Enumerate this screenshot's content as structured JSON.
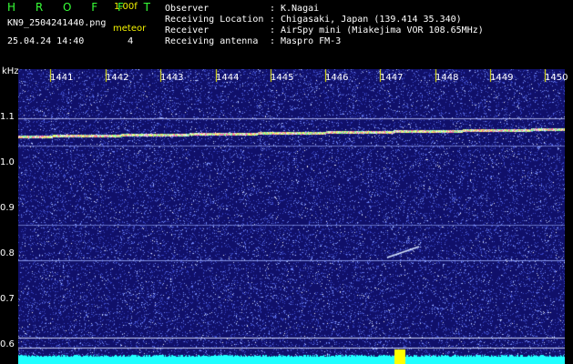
{
  "app": {
    "brand": "H R O F F T",
    "version": "1.00f",
    "file_name": "KN9_2504241440.png",
    "timestamp": "25.04.24 14:40",
    "mode_label": "meteor",
    "mode_value": "4"
  },
  "info": [
    {
      "key": "Observer",
      "value": "K.Nagai"
    },
    {
      "key": "Receiving Location",
      "value": "Chigasaki, Japan (139.414 35.340)"
    },
    {
      "key": "Receiver",
      "value": "AirSpy mini (Miakejima VOR 108.65MHz)"
    },
    {
      "key": "Receiving antenna",
      "value": "Maspro FM-3"
    }
  ],
  "spectrogram": {
    "y_unit": "kHz",
    "y_ticks": [
      "1.1",
      "1.0",
      "0.9",
      "0.8",
      "0.7",
      "0.6"
    ],
    "x_ticks": [
      "1441",
      "1442",
      "1443",
      "1444",
      "1445",
      "1446",
      "1447",
      "1448",
      "1449",
      "1450"
    ],
    "colors": {
      "background": "#10106a",
      "noise": "#7890ff",
      "carrier": "#ffff66",
      "baseline": "#20ffff",
      "marker": "#ffff00"
    }
  }
}
